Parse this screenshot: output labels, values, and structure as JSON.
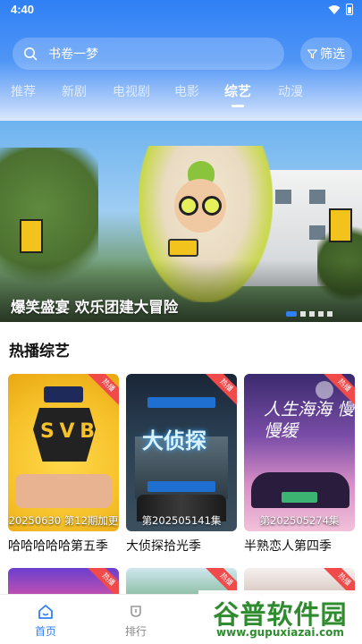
{
  "status_bar": {
    "time": "4:40"
  },
  "search": {
    "placeholder": "书卷一梦"
  },
  "filter": {
    "label": "筛选"
  },
  "tabs": [
    {
      "label": "推荐"
    },
    {
      "label": "新剧"
    },
    {
      "label": "电视剧"
    },
    {
      "label": "电影"
    },
    {
      "label": "综艺",
      "active": true
    },
    {
      "label": "动漫"
    }
  ],
  "banner": {
    "title": "爆笑盛宴 欢乐团建大冒险",
    "slides": 5,
    "active_slide": 1
  },
  "section": {
    "title": "热播综艺"
  },
  "cards": [
    {
      "title": "哈哈哈哈哈第五季",
      "episode": "20250630 第12期加更",
      "badge": "热播"
    },
    {
      "title": "大侦探拾光季",
      "episode": "第202505141集",
      "badge": "热播"
    },
    {
      "title": "半熟恋人第四季",
      "episode": "第202505274集",
      "badge": "热播"
    }
  ],
  "poster_text": {
    "p2_title": "大侦探",
    "p3_title": "人生海海 慢慢缓"
  },
  "bottom_nav": [
    {
      "label": "首页",
      "active": true
    },
    {
      "label": "排行"
    }
  ],
  "watermark": {
    "main": "谷普软件园",
    "url": "www.gupuxiazai.com"
  },
  "colors": {
    "accent": "#2f80f5",
    "hot_badge": "#f04a4a",
    "watermark": "#2e8b2e"
  }
}
